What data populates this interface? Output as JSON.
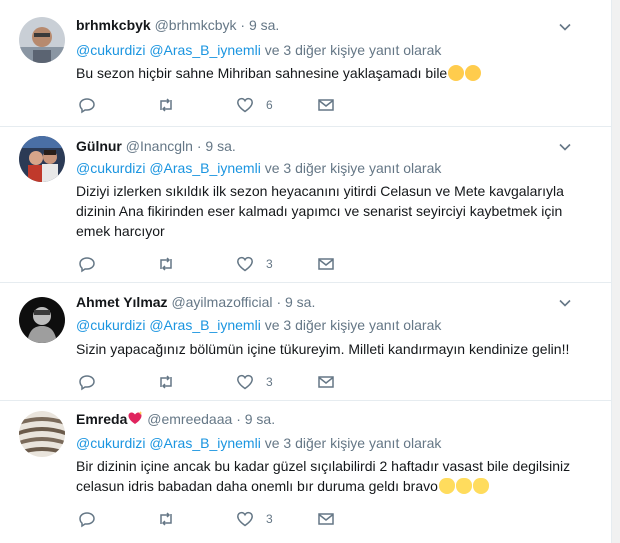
{
  "tweets": [
    {
      "name": "brhmkcbyk",
      "handle": "@brhmkcbyk",
      "dot": "·",
      "time": "9 sa.",
      "reply_mention_1": "@cukurdizi",
      "reply_mention_2": "@Aras_B_iynemli",
      "reply_suffix": "ve 3 diğer kişiye yanıt olarak",
      "text": "Bu sezon hiçbir sahne Mihriban sahnesine yaklaşamadı bile",
      "emojis": [
        "thinking-face",
        "thinking-face"
      ],
      "likes": "6"
    },
    {
      "name": "Gülnur",
      "handle": "@Inancgln",
      "dot": "·",
      "time": "9 sa.",
      "reply_mention_1": "@cukurdizi",
      "reply_mention_2": "@Aras_B_iynemli",
      "reply_suffix": "ve 3 diğer kişiye yanıt olarak",
      "text_lines": [
        "Diziyi izlerken sıkıldık ilk sezon heyacanını yitirdi Celasun ve  Mete kavgalarıyla",
        "dizinin Ana fikirinden eser kalmadı yapımcı ve senarist seyirciyi kaybetmek için",
        "emek harcıyor"
      ],
      "likes": "3"
    },
    {
      "name": "Ahmet Yılmaz",
      "handle": "@ayilmazofficial",
      "dot": "·",
      "time": "9 sa.",
      "reply_mention_1": "@cukurdizi",
      "reply_mention_2": "@Aras_B_iynemli",
      "reply_suffix": "ve 3 diğer kişiye yanıt olarak",
      "text": "Sizin yapacağınız bölümün içine tükureyim. Milleti kandırmayın kendinize gelin!!",
      "likes": "3"
    },
    {
      "name": "Emreda",
      "name_emoji": "sparkling-heart",
      "handle": "@emreedaaa",
      "dot": "·",
      "time": "9 sa.",
      "reply_mention_1": "@cukurdizi",
      "reply_mention_2": "@Aras_B_iynemli",
      "reply_suffix": "ve 3 diğer kişiye yanıt olarak",
      "text_lines": [
        "Bir dizinin içine ancak bu kadar güzel sıçılabilirdi 2 haftadır vasast bile degilsiniz",
        "celasun idris babadan daha onemlı bır duruma geldı bravo"
      ],
      "emojis": [
        "clapping-hands",
        "clapping-hands",
        "clapping-hands"
      ],
      "likes": "3"
    }
  ],
  "colors": {
    "link": "#1b95e0",
    "secondary": "#657786",
    "text": "#14171a",
    "divider": "#e6ecf0"
  }
}
